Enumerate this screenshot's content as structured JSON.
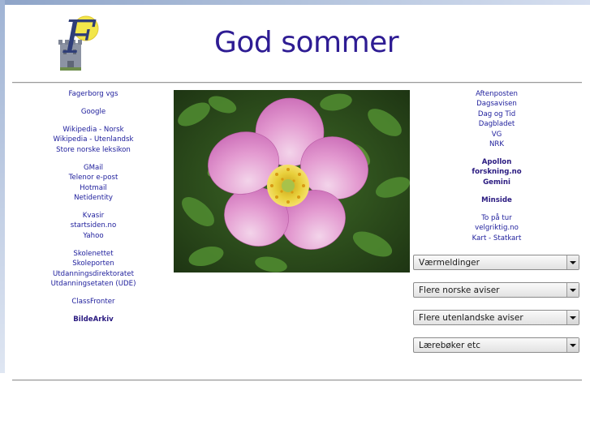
{
  "header": {
    "logo_letter": "F",
    "headline": "God sommer"
  },
  "left_links": [
    [
      {
        "label": "Fagerborg vgs"
      }
    ],
    [
      {
        "label": "Google"
      }
    ],
    [
      {
        "label": "Wikipedia - Norsk"
      },
      {
        "label": "Wikipedia - Utenlandsk"
      },
      {
        "label": "Store norske leksikon"
      }
    ],
    [
      {
        "label": "GMail"
      },
      {
        "label": "Telenor e-post"
      },
      {
        "label": "Hotmail"
      },
      {
        "label": "Netidentity"
      }
    ],
    [
      {
        "label": "Kvasir"
      },
      {
        "label": "startsiden.no"
      },
      {
        "label": "Yahoo"
      }
    ],
    [
      {
        "label": "Skolenettet"
      },
      {
        "label": "Skoleporten"
      },
      {
        "label": "Utdanningsdirektoratet"
      },
      {
        "label": "Utdanningsetaten (UDE)"
      }
    ],
    [
      {
        "label": "ClassFronter"
      }
    ],
    [
      {
        "label": "BildeArkiv",
        "bold": true
      }
    ]
  ],
  "right_links": [
    [
      {
        "label": "Aftenposten"
      },
      {
        "label": "Dagsavisen"
      },
      {
        "label": "Dag og Tid"
      },
      {
        "label": "Dagbladet"
      },
      {
        "label": "VG"
      },
      {
        "label": "NRK"
      }
    ],
    [
      {
        "label": "Apollon",
        "bold": true
      },
      {
        "label": "forskning.no",
        "bold": true
      },
      {
        "label": "Gemini",
        "bold": true
      }
    ],
    [
      {
        "label": "Minside",
        "bold": true
      }
    ],
    [
      {
        "label": "To på tur"
      },
      {
        "label": "velgriktig.no"
      },
      {
        "label": "Kart - Statkart"
      }
    ]
  ],
  "dropdowns": [
    {
      "selected": "Værmeldinger"
    },
    {
      "selected": "Flere norske aviser"
    },
    {
      "selected": "Flere utenlandske aviser"
    },
    {
      "selected": "Lærebøker etc"
    }
  ],
  "colors": {
    "headline": "#2e1c93",
    "link": "#1c1c9b",
    "frame": "#8ea4c8"
  }
}
